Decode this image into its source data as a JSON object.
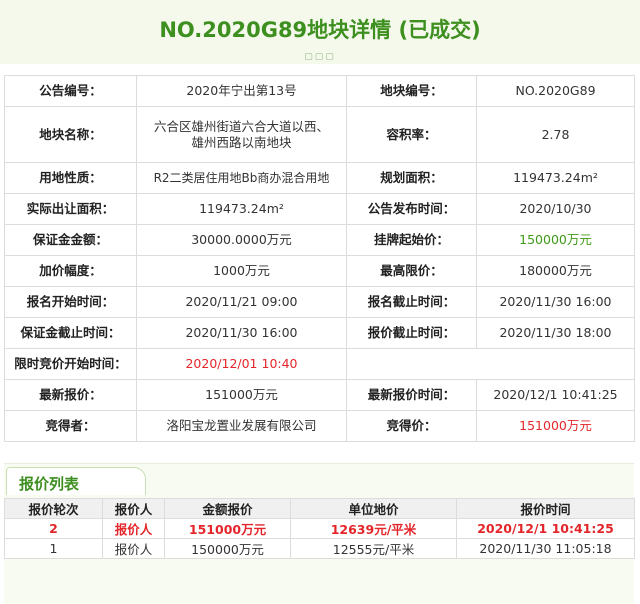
{
  "header": {
    "title": "NO.2020G89地块详情 (已成交)"
  },
  "info": {
    "rows": [
      [
        "公告编号：",
        "2020年宁出第13号",
        "地块编号：",
        "NO.2020G89"
      ],
      [
        "地块名称：",
        "六合区雄州街道六合大道以西、雄州西路以南地块",
        "容积率：",
        "2.78"
      ],
      [
        "用地性质：",
        "R2二类居住用地Bb商办混合用地",
        "规划面积：",
        "119473.24m²"
      ],
      [
        "实际出让面积：",
        "119473.24m²",
        "公告发布时间：",
        "2020/10/30"
      ],
      [
        "保证金金额：",
        "30000.0000万元",
        "挂牌起始价：",
        "150000万元"
      ],
      [
        "加价幅度：",
        "1000万元",
        "最高限价：",
        "180000万元"
      ],
      [
        "报名开始时间：",
        "2020/11/21 09:00",
        "报名截止时间：",
        "2020/11/30 16:00"
      ],
      [
        "保证金截止时间：",
        "2020/11/30 16:00",
        "报价截止时间：",
        "2020/11/30 18:00"
      ],
      [
        "限时竞价开始时间：",
        "2020/12/01 10:40"
      ],
      [
        "最新报价：",
        "151000万元",
        "最新报价时间：",
        "2020/12/1 10:41:25"
      ],
      [
        "竞得者：",
        "洛阳宝龙置业发展有限公司",
        "竞得价：",
        "151000万元"
      ]
    ]
  },
  "bids": {
    "tab_label": "报价列表",
    "headers": [
      "报价轮次",
      "报价人",
      "金额报价",
      "单位地价",
      "报价时间"
    ],
    "rows": [
      [
        "2",
        "报价人",
        "151000万元",
        "12639元/平米",
        "2020/12/1 10:41:25"
      ],
      [
        "1",
        "报价人",
        "150000万元",
        "12555元/平米",
        "2020/11/30 11:05:18"
      ]
    ]
  },
  "colors": {
    "title_green": "#3d8f1f",
    "price_green": "#3f9b16",
    "highlight_red": "#e4262b"
  }
}
